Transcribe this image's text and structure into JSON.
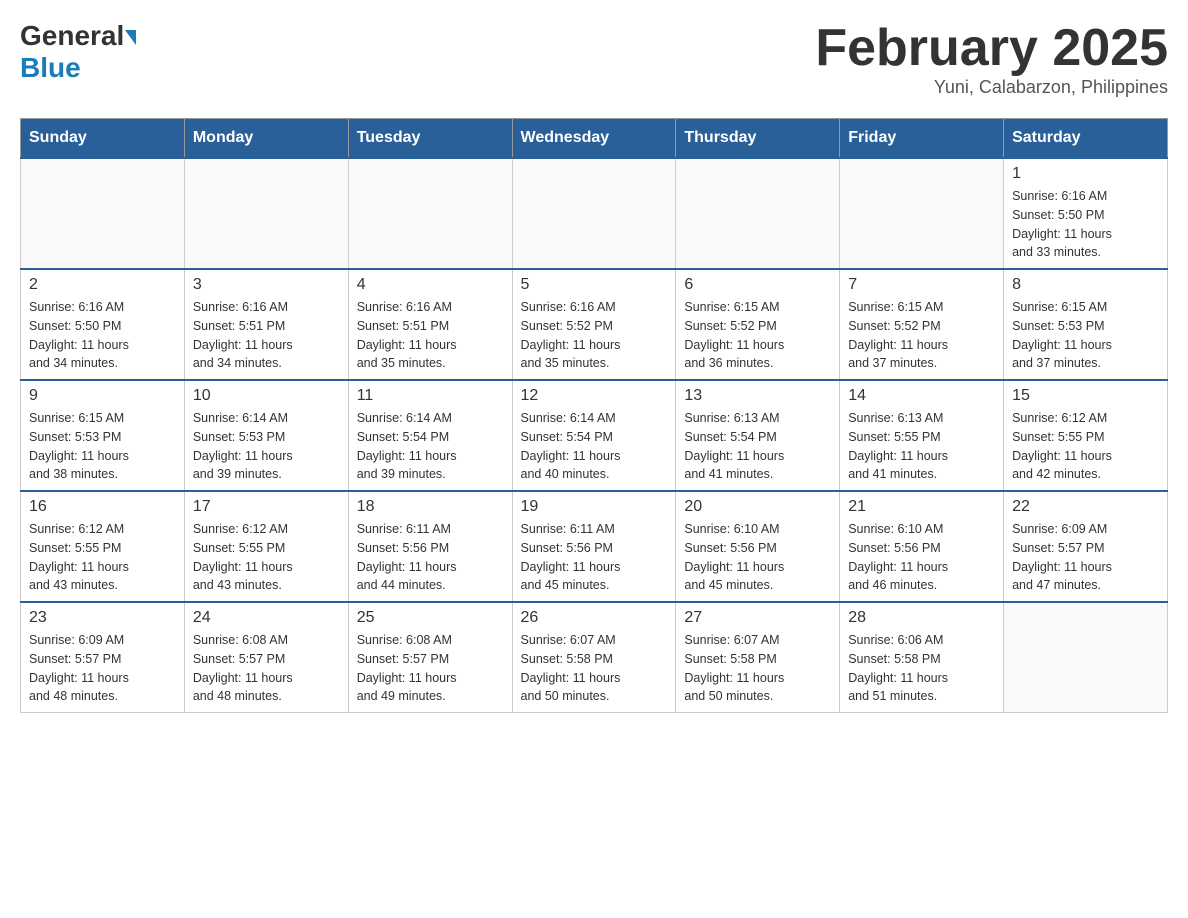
{
  "header": {
    "logo_general": "General",
    "logo_blue": "Blue",
    "title": "February 2025",
    "subtitle": "Yuni, Calabarzon, Philippines"
  },
  "days_of_week": [
    "Sunday",
    "Monday",
    "Tuesday",
    "Wednesday",
    "Thursday",
    "Friday",
    "Saturday"
  ],
  "weeks": [
    {
      "days": [
        {
          "number": "",
          "info": ""
        },
        {
          "number": "",
          "info": ""
        },
        {
          "number": "",
          "info": ""
        },
        {
          "number": "",
          "info": ""
        },
        {
          "number": "",
          "info": ""
        },
        {
          "number": "",
          "info": ""
        },
        {
          "number": "1",
          "info": "Sunrise: 6:16 AM\nSunset: 5:50 PM\nDaylight: 11 hours\nand 33 minutes."
        }
      ]
    },
    {
      "days": [
        {
          "number": "2",
          "info": "Sunrise: 6:16 AM\nSunset: 5:50 PM\nDaylight: 11 hours\nand 34 minutes."
        },
        {
          "number": "3",
          "info": "Sunrise: 6:16 AM\nSunset: 5:51 PM\nDaylight: 11 hours\nand 34 minutes."
        },
        {
          "number": "4",
          "info": "Sunrise: 6:16 AM\nSunset: 5:51 PM\nDaylight: 11 hours\nand 35 minutes."
        },
        {
          "number": "5",
          "info": "Sunrise: 6:16 AM\nSunset: 5:52 PM\nDaylight: 11 hours\nand 35 minutes."
        },
        {
          "number": "6",
          "info": "Sunrise: 6:15 AM\nSunset: 5:52 PM\nDaylight: 11 hours\nand 36 minutes."
        },
        {
          "number": "7",
          "info": "Sunrise: 6:15 AM\nSunset: 5:52 PM\nDaylight: 11 hours\nand 37 minutes."
        },
        {
          "number": "8",
          "info": "Sunrise: 6:15 AM\nSunset: 5:53 PM\nDaylight: 11 hours\nand 37 minutes."
        }
      ]
    },
    {
      "days": [
        {
          "number": "9",
          "info": "Sunrise: 6:15 AM\nSunset: 5:53 PM\nDaylight: 11 hours\nand 38 minutes."
        },
        {
          "number": "10",
          "info": "Sunrise: 6:14 AM\nSunset: 5:53 PM\nDaylight: 11 hours\nand 39 minutes."
        },
        {
          "number": "11",
          "info": "Sunrise: 6:14 AM\nSunset: 5:54 PM\nDaylight: 11 hours\nand 39 minutes."
        },
        {
          "number": "12",
          "info": "Sunrise: 6:14 AM\nSunset: 5:54 PM\nDaylight: 11 hours\nand 40 minutes."
        },
        {
          "number": "13",
          "info": "Sunrise: 6:13 AM\nSunset: 5:54 PM\nDaylight: 11 hours\nand 41 minutes."
        },
        {
          "number": "14",
          "info": "Sunrise: 6:13 AM\nSunset: 5:55 PM\nDaylight: 11 hours\nand 41 minutes."
        },
        {
          "number": "15",
          "info": "Sunrise: 6:12 AM\nSunset: 5:55 PM\nDaylight: 11 hours\nand 42 minutes."
        }
      ]
    },
    {
      "days": [
        {
          "number": "16",
          "info": "Sunrise: 6:12 AM\nSunset: 5:55 PM\nDaylight: 11 hours\nand 43 minutes."
        },
        {
          "number": "17",
          "info": "Sunrise: 6:12 AM\nSunset: 5:55 PM\nDaylight: 11 hours\nand 43 minutes."
        },
        {
          "number": "18",
          "info": "Sunrise: 6:11 AM\nSunset: 5:56 PM\nDaylight: 11 hours\nand 44 minutes."
        },
        {
          "number": "19",
          "info": "Sunrise: 6:11 AM\nSunset: 5:56 PM\nDaylight: 11 hours\nand 45 minutes."
        },
        {
          "number": "20",
          "info": "Sunrise: 6:10 AM\nSunset: 5:56 PM\nDaylight: 11 hours\nand 45 minutes."
        },
        {
          "number": "21",
          "info": "Sunrise: 6:10 AM\nSunset: 5:56 PM\nDaylight: 11 hours\nand 46 minutes."
        },
        {
          "number": "22",
          "info": "Sunrise: 6:09 AM\nSunset: 5:57 PM\nDaylight: 11 hours\nand 47 minutes."
        }
      ]
    },
    {
      "days": [
        {
          "number": "23",
          "info": "Sunrise: 6:09 AM\nSunset: 5:57 PM\nDaylight: 11 hours\nand 48 minutes."
        },
        {
          "number": "24",
          "info": "Sunrise: 6:08 AM\nSunset: 5:57 PM\nDaylight: 11 hours\nand 48 minutes."
        },
        {
          "number": "25",
          "info": "Sunrise: 6:08 AM\nSunset: 5:57 PM\nDaylight: 11 hours\nand 49 minutes."
        },
        {
          "number": "26",
          "info": "Sunrise: 6:07 AM\nSunset: 5:58 PM\nDaylight: 11 hours\nand 50 minutes."
        },
        {
          "number": "27",
          "info": "Sunrise: 6:07 AM\nSunset: 5:58 PM\nDaylight: 11 hours\nand 50 minutes."
        },
        {
          "number": "28",
          "info": "Sunrise: 6:06 AM\nSunset: 5:58 PM\nDaylight: 11 hours\nand 51 minutes."
        },
        {
          "number": "",
          "info": ""
        }
      ]
    }
  ]
}
